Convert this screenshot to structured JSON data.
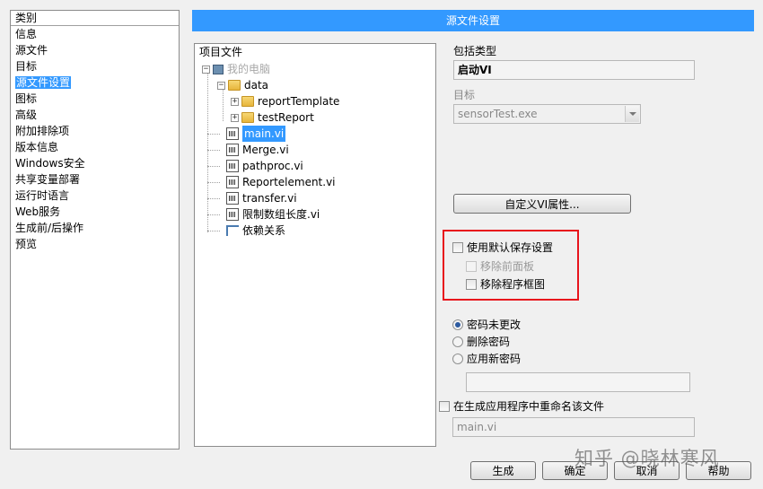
{
  "categories": {
    "header": "类别",
    "items": [
      "信息",
      "源文件",
      "目标",
      "源文件设置",
      "图标",
      "高级",
      "附加排除项",
      "版本信息",
      "Windows安全",
      "共享变量部署",
      "运行时语言",
      "Web服务",
      "生成前/后操作",
      "预览"
    ],
    "selected": "源文件设置"
  },
  "title": "源文件设置",
  "tree": {
    "header": "项目文件",
    "root": "我的电脑",
    "folder": "data",
    "subfolders": [
      "reportTemplate",
      "testReport"
    ],
    "files": [
      "main.vi",
      "Merge.vi",
      "pathproc.vi",
      "Reportelement.vi",
      "transfer.vi",
      "限制数组长度.vi"
    ],
    "dependencies": "依赖关系",
    "selected": "main.vi",
    "icons": {
      "root": "computer-icon",
      "folder": "folder-icon",
      "file": "vi-file-icon",
      "dependencies": "dependencies-icon"
    }
  },
  "settings": {
    "inclusion_type_label": "包括类型",
    "inclusion_type_value": "启动VI",
    "destination_label": "目标",
    "destination_value": "sensorTest.exe",
    "custom_vi_props_button": "自定义VI属性...",
    "use_default_save": "使用默认保存设置",
    "remove_front_panel": "移除前面板",
    "remove_block_diagram": "移除程序框图",
    "password_unchanged": "密码未更改",
    "remove_password": "删除密码",
    "apply_new_password": "应用新密码",
    "rename_file": "在生成应用程序中重命名该文件",
    "rename_value": "main.vi"
  },
  "buttons": {
    "build": "生成",
    "ok": "确定",
    "cancel": "取消",
    "help": "帮助"
  },
  "watermark": "知乎 @晓林寒风",
  "colors": {
    "accent": "#3399ff",
    "highlight": "#e8141c"
  }
}
